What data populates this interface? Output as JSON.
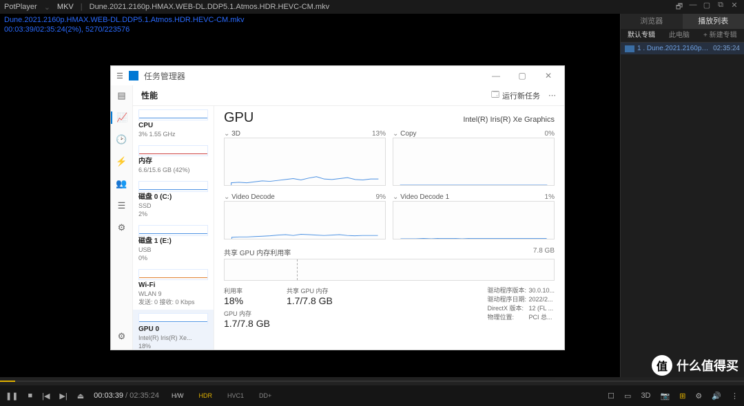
{
  "player": {
    "app_name": "PotPlayer",
    "format": "MKV",
    "filename": "Dune.2021.2160p.HMAX.WEB-DL.DDP5.1.Atmos.HDR.HEVC-CM.mkv",
    "osd_line1": "Dune.2021.2160p.HMAX.WEB-DL.DDP5.1.Atmos.HDR.HEVC-CM.mkv",
    "osd_line2": "00:03:39/02:35:24(2%), 5270/223576",
    "time_current": "00:03:39",
    "time_total": "02:35:24",
    "progress_pct": 2,
    "badge_hw": "H/W",
    "badge_hdr": "HDR",
    "badge_hvc": "HVC1",
    "badge_dd": "DD+",
    "sidepanel": {
      "tab_browser": "浏览器",
      "tab_playlist": "播放列表",
      "sub_default": "默认专辑",
      "sub_thispc": "此电脑",
      "sub_new": "+ 新建专辑",
      "item_name": "1 . Dune.2021.2160p.HMAX.WEB-DL.DDP5...",
      "item_dur": "02:35:24"
    }
  },
  "watermark": {
    "char": "值",
    "text": "什么值得买"
  },
  "tm": {
    "title": "任务管理器",
    "tab_perf": "性能",
    "run_new": "运行新任务",
    "list": [
      {
        "label": "CPU",
        "sub": "3% 1.55 GHz",
        "spark": "blue"
      },
      {
        "label": "内存",
        "sub": "6.6/15.6 GB (42%)",
        "spark": "red"
      },
      {
        "label": "磁盘 0 (C:)",
        "sub": "SSD\n2%",
        "spark": "blue"
      },
      {
        "label": "磁盘 1 (E:)",
        "sub": "USB\n0%",
        "spark": "blue"
      },
      {
        "label": "Wi-Fi",
        "sub": "WLAN 9\n发送: 0 接收: 0 Kbps",
        "spark": "orange"
      },
      {
        "label": "GPU 0",
        "sub": "Intel(R) Iris(R) Xe...\n18%",
        "spark": "blue",
        "sel": true
      }
    ],
    "detail": {
      "name": "GPU",
      "device": "Intel(R) Iris(R) Xe Graphics",
      "charts": [
        {
          "title": "3D",
          "pct": "13%",
          "drop": true
        },
        {
          "title": "Copy",
          "pct": "0%",
          "drop": true
        },
        {
          "title": "Video Decode",
          "pct": "9%",
          "drop": true
        },
        {
          "title": "Video Decode 1",
          "pct": "1%",
          "drop": true
        }
      ],
      "mem_title": "共享 GPU 内存利用率",
      "mem_total": "7.8 GB",
      "stats": {
        "util_k": "利用率",
        "util_v": "18%",
        "shared_k": "共享 GPU 内存",
        "shared_v": "1.7/7.8 GB",
        "gpumem_k": "GPU 内存",
        "gpumem_v": "1.7/7.8 GB",
        "drv_ver_k": "驱动程序版本:",
        "drv_ver_v": "30.0.10...",
        "drv_date_k": "驱动程序日期:",
        "drv_date_v": "2022/2...",
        "dx_k": "DirectX 版本:",
        "dx_v": "12 (FL ...",
        "loc_k": "物理位置:",
        "loc_v": "PCI 总..."
      }
    }
  },
  "chart_data": [
    {
      "type": "line",
      "title": "3D",
      "ylim": [
        0,
        100
      ],
      "values": [
        5,
        6,
        5,
        7,
        9,
        8,
        10,
        12,
        14,
        11,
        15,
        18,
        13,
        12,
        14,
        16,
        12,
        11,
        13,
        13
      ]
    },
    {
      "type": "line",
      "title": "Copy",
      "ylim": [
        0,
        100
      ],
      "values": [
        0,
        0,
        0,
        0,
        0,
        0,
        0,
        0,
        0,
        0,
        0,
        0,
        0,
        0,
        0,
        0,
        0,
        0,
        0,
        0
      ]
    },
    {
      "type": "line",
      "title": "Video Decode",
      "ylim": [
        0,
        100
      ],
      "values": [
        4,
        5,
        5,
        6,
        7,
        8,
        10,
        11,
        9,
        12,
        11,
        10,
        9,
        10,
        11,
        9,
        8,
        9,
        9,
        9
      ]
    },
    {
      "type": "line",
      "title": "Video Decode 1",
      "ylim": [
        0,
        100
      ],
      "values": [
        0,
        0,
        0,
        1,
        0,
        1,
        1,
        1,
        0,
        1,
        1,
        1,
        1,
        1,
        1,
        1,
        1,
        1,
        1,
        1
      ]
    },
    {
      "type": "area",
      "title": "共享 GPU 内存利用率",
      "ylim": [
        0,
        7.8
      ],
      "value": 1.7
    }
  ]
}
